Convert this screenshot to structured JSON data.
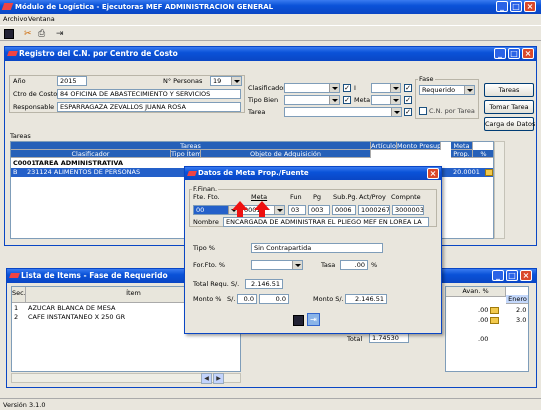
{
  "app": {
    "title": "Módulo de Logística - Ejecutoras MEF ADMINISTRACION GENERAL",
    "menu": [
      "Archivo",
      "Ventana"
    ],
    "status": "Versión 3.1.0"
  },
  "registro": {
    "title": "Registro del C.N. por Centro de Costo",
    "ano_label": "Año",
    "ano_value": "2015",
    "centro_label": "Ctro de Costo",
    "centro_value": "84 OFICINA DE ABASTECIMIENTO Y SERVICIOS",
    "resp_label": "Responsable",
    "resp_value": "ESPARRAGAZA ZEVALLOS JUANA ROSA",
    "personas_label": "N° Personas",
    "personas_value": "19",
    "clasif_label": "Clasificador",
    "clasif_value": "",
    "tipo_label": "Tipo Bien",
    "tipo_value": "",
    "tarea_label": "Tarea",
    "tarea_value": "",
    "i_label": "I",
    "meta_label": "Meta",
    "fase_label": "Fase",
    "fase_value": "Requerido",
    "cn_label": "C.N. por Tarea",
    "buttons": [
      "Tareas",
      "Tomar Tarea",
      "Carga de Datos"
    ],
    "tareas_label": "Tareas",
    "grid_headers": {
      "tareas": "Tareas",
      "clasificador": "Clasificador",
      "tipo": "Tipo Ítem",
      "objeto": "Objeto de Adquisición",
      "articulo": "Artículo",
      "monto": "Monto Presup.",
      "meta": "Meta",
      "prop": "Prop.",
      "pct": "%"
    },
    "rows": [
      {
        "col1": "C0001",
        "col2": "TAREA ADMINISTRATIVA",
        "col3": "",
        "col4": ""
      },
      {
        "col1": "B",
        "col2": "231124 ALIMENTOS DE PERSONAS",
        "col3": "20.0001",
        "col4": ""
      }
    ]
  },
  "lista": {
    "title": "Lista de Items - Fase de Requerido",
    "headers": {
      "sec": "Sec.",
      "item": "Ítem",
      "pct": "Avan. %",
      "enero": "Enero"
    },
    "rows": [
      {
        "sec": "1",
        "item": "AZUCAR BLANCA DE MESA",
        "pct": ".00",
        "enero": "2.0"
      },
      {
        "sec": "2",
        "item": "CAFE INSTANTANEO X 250 GR",
        "pct": ".00",
        "enero": "3.0"
      }
    ],
    "total_label": "Total",
    "total_value": "1.74530",
    "total_pct": ".00"
  },
  "dialog": {
    "title": "Datos de Meta Prop./Fuente",
    "group_label": "F.Finan.",
    "headers": [
      "Fte. Fto.",
      "Meta",
      "Fun",
      "Pg",
      "Sub.Pg.",
      "Act/Proy",
      "Compnte"
    ],
    "fte_value": "00",
    "meta_value": "0001",
    "fun_value": "03",
    "pg_value": "003",
    "subpg_value": "0006",
    "actproy_value": "1000267",
    "compnte_value": "3000003",
    "nombre_label": "Nombre",
    "nombre_value": "ENCARGADA DE ADMINISTRAR EL PLIEGO MEF EN LOREA LA",
    "tipo_label": "Tipo %",
    "tipo_value": "Sin Contrapartida",
    "forfto_label": "For.Fto. %",
    "forfto_value": "",
    "tasa_label": "Tasa",
    "tasa_value": ".00",
    "tasa_unit": "%",
    "totalreq_label": "Total Requ. S/.",
    "totalreq_value": "2.146.51",
    "monto_label": "Monto %",
    "monto_s": "S/.",
    "monto_val1": "0.0",
    "monto_val2": "0.0",
    "monto_s2": "Monto S/.",
    "monto_val3": "2.146.51"
  }
}
